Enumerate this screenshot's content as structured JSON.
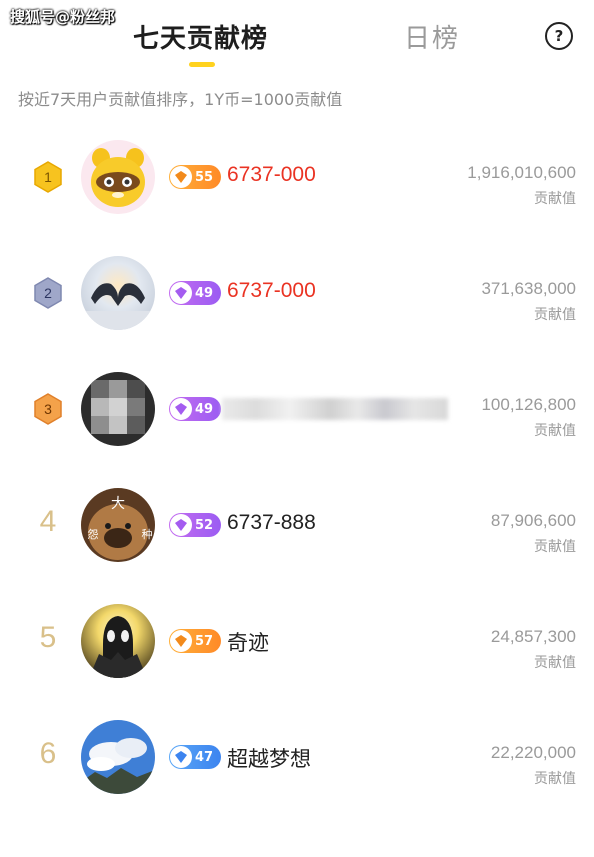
{
  "watermark": "搜狐号@粉丝邦",
  "tabs": {
    "weekly": "七天贡献榜",
    "daily": "日榜"
  },
  "help": "?",
  "subtitle": "按近7天用户贡献值排序，1Y币=1000贡献值",
  "colors": {
    "accent": "#ffd21e",
    "name_red": "#ea3323",
    "gold_rank": "#d9c08a"
  },
  "ranking": [
    {
      "rank": "1",
      "rank_style": "gold-hexagon",
      "avatar": "raccoon-avatar",
      "level": "55",
      "level_color": "orange",
      "name": "6737-000",
      "name_color": "red",
      "value": "1,916,010,600",
      "value_label": "贡献值"
    },
    {
      "rank": "2",
      "rank_style": "silver-hexagon",
      "avatar": "heart-hands-avatar",
      "level": "49",
      "level_color": "purple",
      "name": "6737-000",
      "name_color": "red",
      "value": "371,638,000",
      "value_label": "贡献值"
    },
    {
      "rank": "3",
      "rank_style": "bronze-hexagon",
      "avatar": "blurred-avatar",
      "level": "49",
      "level_color": "purple",
      "name": "",
      "name_blurred": true,
      "value": "100,126,800",
      "value_label": "贡献值"
    },
    {
      "rank": "4",
      "rank_style": "number",
      "avatar": "dog-avatar",
      "avatar_text": [
        "大",
        "怨",
        "种"
      ],
      "level": "52",
      "level_color": "purple",
      "name": "6737-888",
      "name_color": "default",
      "value": "87,906,600",
      "value_label": "贡献值"
    },
    {
      "rank": "5",
      "rank_style": "number",
      "avatar": "ultraman-avatar",
      "level": "57",
      "level_color": "orange",
      "name": "奇迹",
      "name_color": "default",
      "value": "24,857,300",
      "value_label": "贡献值"
    },
    {
      "rank": "6",
      "rank_style": "number",
      "avatar": "sky-avatar",
      "level": "47",
      "level_color": "blue",
      "name": "超越梦想",
      "name_color": "default",
      "value": "22,220,000",
      "value_label": "贡献值"
    }
  ]
}
